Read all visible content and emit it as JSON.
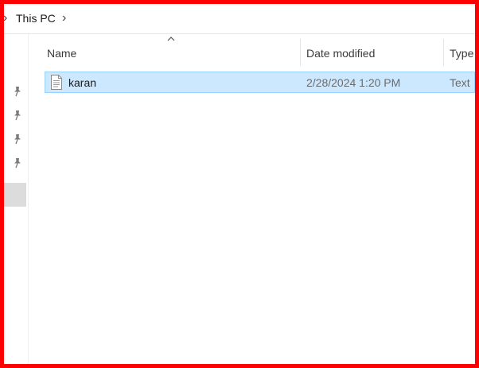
{
  "address": {
    "location": "This PC"
  },
  "columns": {
    "name": "Name",
    "date_modified": "Date modified",
    "type": "Type"
  },
  "files": [
    {
      "name": "karan",
      "date_modified": "2/28/2024 1:20 PM",
      "type": "Text",
      "icon": "text-file-icon"
    }
  ],
  "nav": {
    "pins": [
      "pin-icon",
      "pin-icon",
      "pin-icon",
      "pin-icon"
    ]
  },
  "colors": {
    "frame": "#ff0000",
    "selection": "#cce8ff",
    "selection_border": "#99d1ff"
  }
}
